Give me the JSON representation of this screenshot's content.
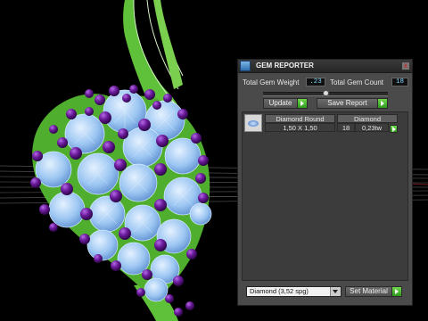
{
  "panel": {
    "title": "GEM REPORTER",
    "close_glyph": "x",
    "total_weight_label": "Total Gem Weight",
    "total_weight_value": ".23",
    "total_count_label": "Total Gem Count",
    "total_count_value": "18",
    "slider_value": 0.5,
    "update_label": "Update",
    "save_report_label": "Save Report",
    "gem": {
      "name_header": "Diamond Round",
      "size": "1,50 X 1,50",
      "material_header": "Diamond",
      "count": "18",
      "weight": "0,23tw"
    },
    "material_select": "Diamond   (3,52 spg)",
    "set_material_label": "Set Material"
  },
  "colors": {
    "stem": "#5fc03a",
    "gem_blue": "#9cc6f2",
    "prong_purple": "#6a1a9a",
    "accent_green": "#3fbf2a"
  }
}
